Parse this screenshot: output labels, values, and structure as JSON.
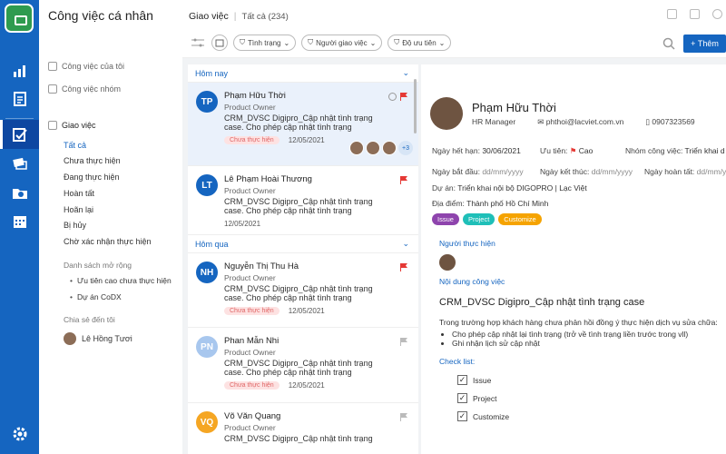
{
  "nav": {
    "title": "Công việc cá nhân",
    "my_tasks": "Công việc của tôi",
    "group_tasks": "Công việc nhóm",
    "tasks_header": "Giao việc",
    "sub_items": [
      "Tất cả",
      "Chưa thực hiện",
      "Đang thực hiện",
      "Hoàn tất",
      "Hoãn lại",
      "Bị hủy",
      "Chờ xác nhận thực hiện"
    ],
    "ext_header": "Danh sách mở rộng",
    "ext_items": [
      "Ưu tiên cao chưa thực hiện",
      "Dự án CoDX"
    ],
    "shared_header": "Chia sẻ đến tôi",
    "shared_user": "Lê Hồng Tươi"
  },
  "top": {
    "title": "Giao việc",
    "count_label": "Tất cả (234)",
    "filters": [
      "Tình trạng",
      "Người giao việc",
      "Độ ưu tiên"
    ],
    "add_label": "Thêm",
    "add_prefix": "+"
  },
  "groups": {
    "today": "Hôm nay",
    "yesterday": "Hôm qua"
  },
  "cards": [
    {
      "initials": "TP",
      "name": "Phạm Hữu Thời",
      "role": "Product Owner",
      "desc": "CRM_DVSC Digipro_Cập nhật tình trạng case. Cho phép cập nhật tình trạng",
      "status": "Chưa thực hiện",
      "date": "12/05/2021",
      "more": "+3"
    },
    {
      "initials": "LT",
      "name": "Lê Phạm Hoài Thương",
      "role": "Product Owner",
      "desc": "CRM_DVSC Digipro_Cập nhật tình trạng case. Cho phép cập nhật tình trạng",
      "date": "12/05/2021"
    },
    {
      "initials": "NH",
      "name": "Nguyễn Thị Thu Hà",
      "role": "Product Owner",
      "desc": "CRM_DVSC Digipro_Cập nhật tình trạng case. Cho phép cập nhật tình trạng",
      "status": "Chưa thực hiện",
      "date": "12/05/2021"
    },
    {
      "initials": "PN",
      "name": "Phan Mẫn Nhi",
      "role": "Product Owner",
      "desc": "CRM_DVSC Digipro_Cập nhật tình trạng case. Cho phép cập nhật tình trạng",
      "status": "Chưa thực hiện",
      "date": "12/05/2021"
    },
    {
      "initials": "VQ",
      "name": "Võ Văn Quang",
      "role": "Product Owner",
      "desc": "CRM_DVSC Digipro_Cập nhật tình trạng"
    }
  ],
  "detail": {
    "name": "Phạm Hữu Thời",
    "position": "HR Manager",
    "email": "phthoi@lacviet.com.vn",
    "phone": "0907323569",
    "due_label": "Ngày hết hạn:",
    "due_value": "30/06/2021",
    "priority_label": "Ưu tiên:",
    "priority_value": "Cao",
    "group_label": "Nhóm công việc:",
    "group_value": "Triển khai d",
    "start_label": "Ngày bắt đầu:",
    "start_value": "dd/mm/yyyy",
    "end_label": "Ngày kết thúc:",
    "end_value": "dd/mm/yyyy",
    "done_label": "Ngày hoàn tất:",
    "done_value": "dd/mm/yyyy",
    "project_label": "Dự án:",
    "project_value": "Triển khai nội bộ DIGOPRO | Lạc Việt",
    "place_label": "Địa điểm:",
    "place_value": "Thành phố Hồ Chí Minh",
    "tags": [
      {
        "label": "Issue",
        "color": "#8e44ad"
      },
      {
        "label": "Project",
        "color": "#1fbfb8"
      },
      {
        "label": "Customize",
        "color": "#f5a300"
      }
    ],
    "assignee_header": "Người thực hiện",
    "content_header": "Nội dung công việc",
    "content_title": "CRM_DVSC Digipro_Cập nhật tình trạng case",
    "content_para": "Trong trường hợp khách hàng chưa phản hồi đồng ý thực hiện dịch vụ sửa chữa:",
    "bullets": [
      "Cho phép cập nhật lại tình trạng (trở về tình trạng liền trước trong vll)",
      "Ghi nhận lịch sử cập nhật"
    ],
    "checklist_header": "Check list:",
    "checklist": [
      "Issue",
      "Project",
      "Customize"
    ]
  }
}
